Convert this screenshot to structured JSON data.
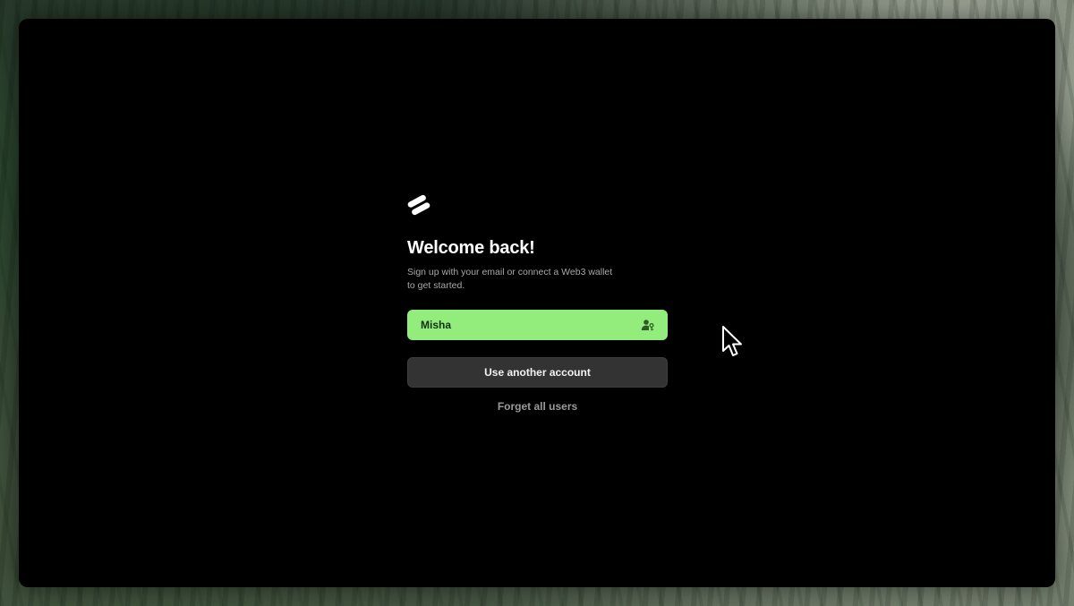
{
  "login": {
    "logo_icon": "stripes-logo-icon",
    "title": "Welcome back!",
    "subtitle": "Sign up with your email or connect a Web3 wallet to get started.",
    "saved_account": {
      "name": "Misha",
      "icon": "user-key-icon"
    },
    "another_account_label": "Use another account",
    "forget_label": "Forget all users"
  },
  "cursor": {
    "icon": "mouse-pointer-icon"
  },
  "colors": {
    "window_bg": "#000000",
    "accent_green": "#92ed7c",
    "secondary_button": "#333333",
    "muted_text": "#9a9a9a"
  }
}
